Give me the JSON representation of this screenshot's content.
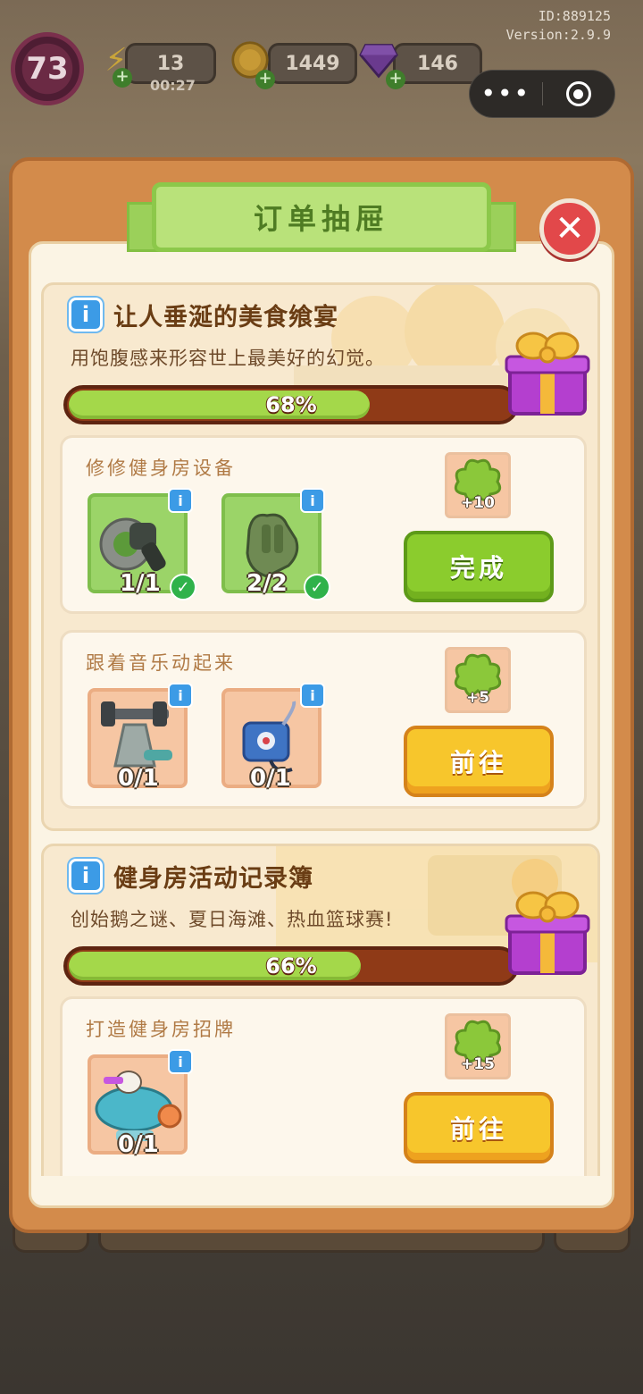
{
  "hud": {
    "level": "73",
    "energy": "13",
    "energy_timer": "00:27",
    "coins": "1449",
    "gems": "146",
    "player_id": "ID:889125",
    "version": "Version:2.9.9"
  },
  "dialog": {
    "title": "订单抽屉",
    "sections": [
      {
        "title": "让人垂涎的美食飨宴",
        "desc": "用饱腹感来形容世上最美好的幻觉。",
        "progress": 68,
        "progress_label": "68%",
        "tasks": [
          {
            "name": "修修健身房设备",
            "items": [
              {
                "icon": "grinder-tool-icon",
                "count": "1/1",
                "done": true
              },
              {
                "icon": "glove-icon",
                "count": "2/2",
                "done": true
              }
            ],
            "reward": "+10",
            "button": "完成"
          },
          {
            "name": "跟着音乐动起来",
            "items": [
              {
                "icon": "dumbbell-rack-icon",
                "count": "0/1",
                "done": false
              },
              {
                "icon": "music-player-icon",
                "count": "0/1",
                "done": false
              }
            ],
            "reward": "+5",
            "button": "前往"
          }
        ]
      },
      {
        "title": "健身房活动记录簿",
        "desc": "创始鹅之谜、夏日海滩、热血篮球赛!",
        "progress": 66,
        "progress_label": "66%",
        "tasks": [
          {
            "name": "打造健身房招牌",
            "items": [
              {
                "icon": "gym-sign-icon",
                "count": "0/1",
                "done": false
              }
            ],
            "reward": "+15",
            "button": "前往"
          }
        ]
      }
    ]
  },
  "colors": {
    "panel": "#d38b4b",
    "banner": "#b9e27a",
    "progress_fill": "#a4d84a",
    "button_green": "#8bcc2d",
    "button_yellow": "#f7c62c",
    "close": "#e2484a"
  }
}
